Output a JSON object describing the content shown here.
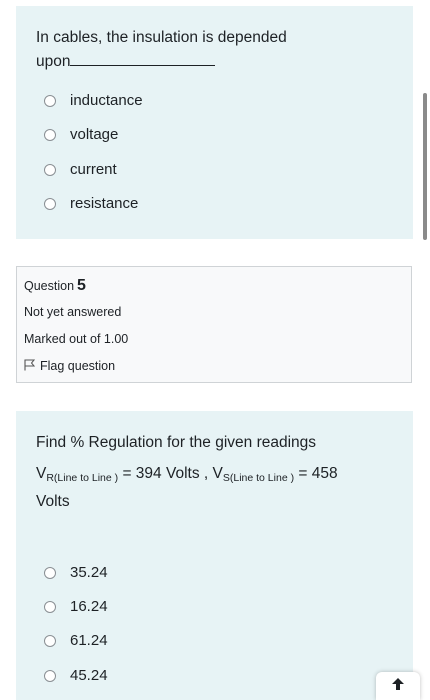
{
  "question1": {
    "text_line1": "In cables, the insulation is depended",
    "text_line2": "upon",
    "options": [
      "inductance",
      "voltage",
      "current",
      "resistance"
    ]
  },
  "question2_info": {
    "question_label": "Question",
    "question_number": "5",
    "status": "Not yet answered",
    "marks": "Marked out of 1.00",
    "flag_label": "Flag question"
  },
  "question2": {
    "prompt": "Find % Regulation for the given readings",
    "vr_symbol": "V",
    "vr_subscript": "R(Line to Line )",
    "vr_value": "= 394 Volts ,",
    "vs_symbol": "V",
    "vs_subscript": "S(Line to Line )",
    "vs_value": "= 458",
    "units": "Volts",
    "options": [
      "35.24",
      "16.24",
      "61.24",
      "45.24"
    ]
  },
  "icons": {
    "flag": "flag-icon",
    "scroll_up": "arrow-up-icon"
  }
}
